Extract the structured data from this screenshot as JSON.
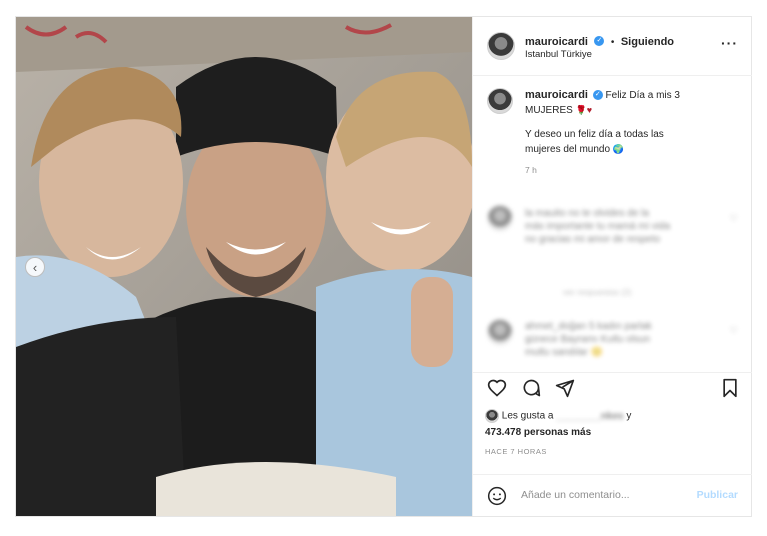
{
  "post": {
    "username": "mauroicardi",
    "verified_mark": "✓",
    "separator": "•",
    "follow_status": "Siguiendo",
    "location": "Istanbul Türkiye",
    "more_glyph": "···"
  },
  "caption": {
    "username": "mauroicardi",
    "text_line1": "Feliz Día a mis 3",
    "text_line2": "MUJERES",
    "emoji": "🌹♥",
    "text_line3": "Y deseo un feliz día a todas las",
    "text_line4": "mujeres del mundo",
    "globe": "🌍",
    "time": "7 h"
  },
  "comments": [
    {
      "line1": "la mauito no te olvides de la",
      "line2": "más importante tu mamá mi vida",
      "line3": "no gracias mi amor de respeto"
    },
    {
      "line1": "ver respuestas (2)"
    },
    {
      "user": "ahmet_doğan",
      "line1": "ahmet_doğan 5 kadın parlak",
      "line2": "günece Bayramı Kutlu olsun",
      "line3": "mutlu sandılar 🙂"
    }
  ],
  "likes": {
    "prefix": "Les gusta a",
    "blurred_user": "________nkes",
    "and": "y",
    "count": "473.478 personas más"
  },
  "age": "HACE 7 HORAS",
  "comment_bar": {
    "placeholder": "Añade un comentario...",
    "publish": "Publicar"
  },
  "icons": {
    "like": "heart-icon",
    "comment": "comment-icon",
    "share": "share-icon",
    "save": "bookmark-icon",
    "emoji": "emoji-icon",
    "prev": "chevron-left-icon"
  },
  "colors": {
    "verified": "#3897f0",
    "publish": "#b3dbff",
    "muted": "#8e8e8e"
  }
}
